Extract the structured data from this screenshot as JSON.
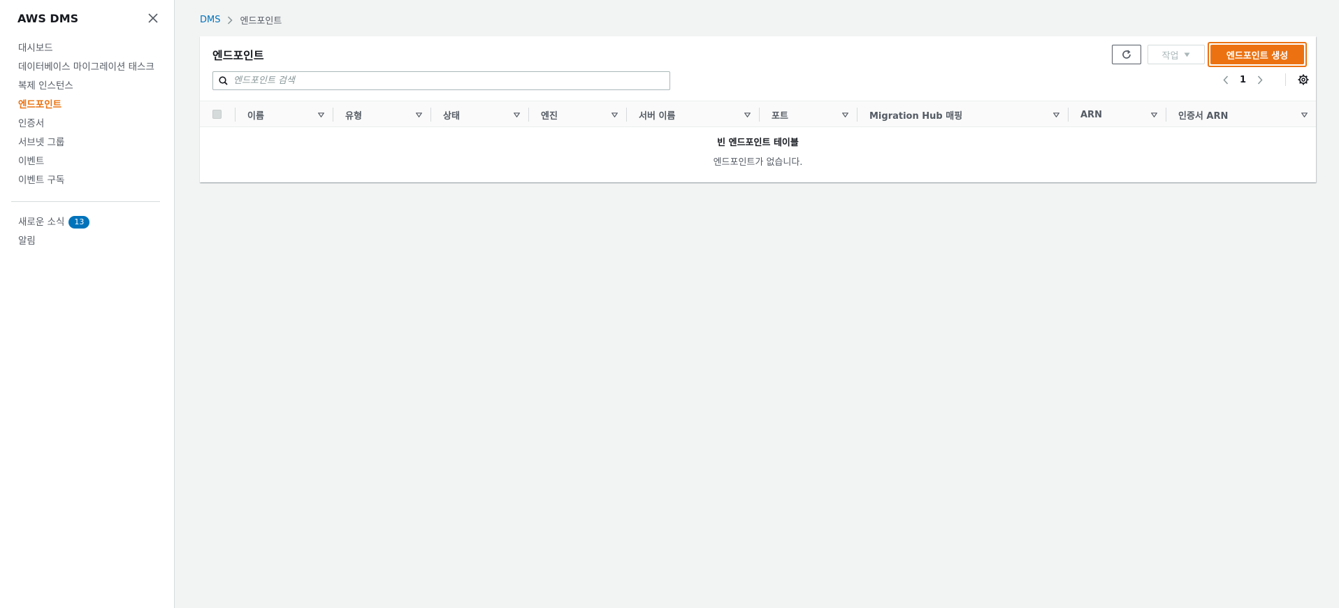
{
  "sidebar": {
    "title": "AWS DMS",
    "items": [
      {
        "label": "대시보드"
      },
      {
        "label": "데이터베이스 마이그레이션 태스크"
      },
      {
        "label": "복제 인스턴스"
      },
      {
        "label": "엔드포인트",
        "active": true
      },
      {
        "label": "인증서"
      },
      {
        "label": "서브넷 그룹"
      },
      {
        "label": "이벤트"
      },
      {
        "label": "이벤트 구독"
      }
    ],
    "secondary": [
      {
        "label": "새로운 소식",
        "badge": "13"
      },
      {
        "label": "알림"
      }
    ]
  },
  "breadcrumb": {
    "root": "DMS",
    "current": "엔드포인트"
  },
  "panel": {
    "title": "엔드포인트",
    "search_placeholder": "엔드포인트 검색",
    "actions_label": "작업",
    "create_label": "엔드포인트 생성",
    "page": "1"
  },
  "table": {
    "columns": [
      "이름",
      "유형",
      "상태",
      "엔진",
      "서버 이름",
      "포트",
      "Migration Hub 매핑",
      "ARN",
      "인증서 ARN"
    ],
    "empty_title": "빈 엔드포인트 테이블",
    "empty_message": "엔드포인트가 없습니다."
  },
  "colors": {
    "accent": "#ec7211",
    "link": "#0073bb",
    "badge": "#0073bb"
  }
}
